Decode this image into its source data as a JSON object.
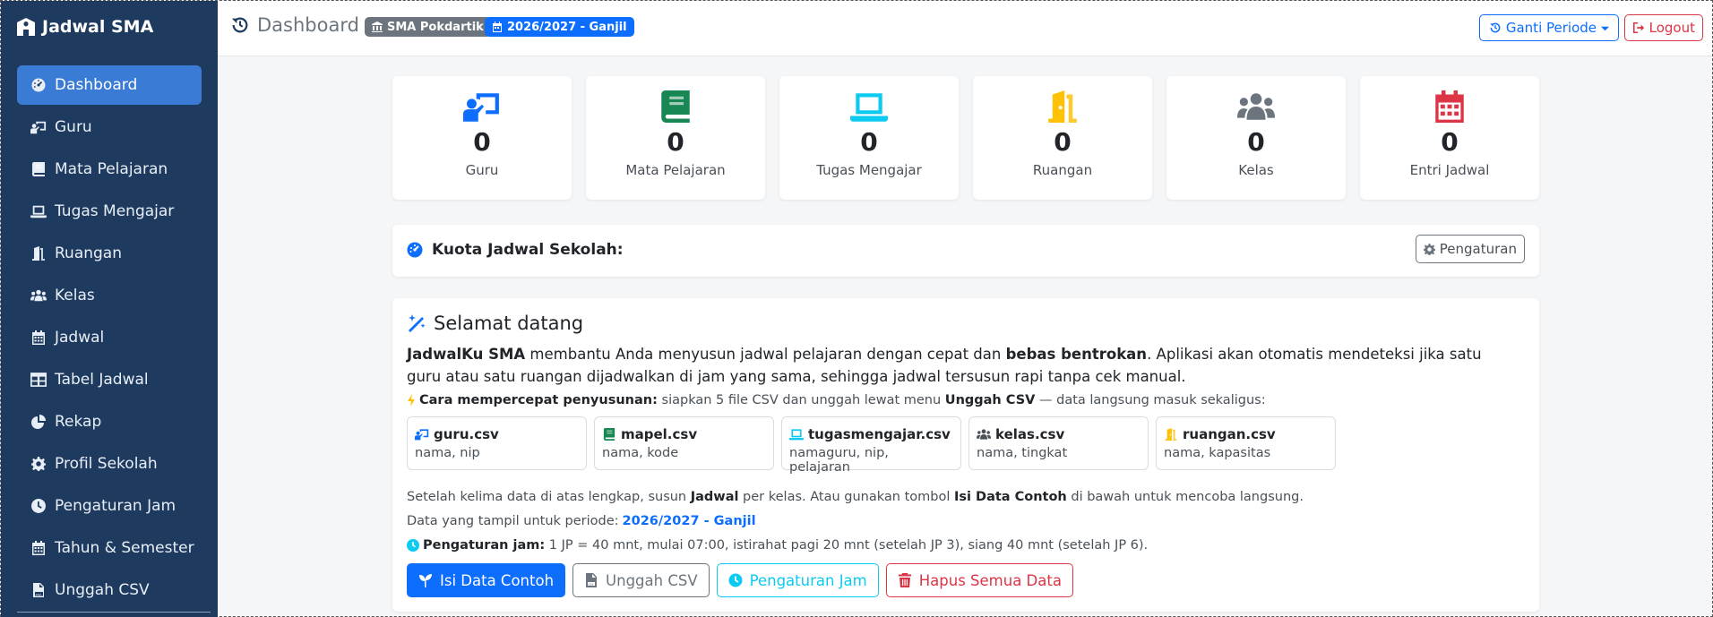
{
  "brand": {
    "name": "Jadwal SMA"
  },
  "sidebar": {
    "items": [
      {
        "label": "Dashboard",
        "icon": "dashboard-icon",
        "active": true
      },
      {
        "label": "Guru",
        "icon": "teacher-icon"
      },
      {
        "label": "Mata Pelajaran",
        "icon": "book-icon"
      },
      {
        "label": "Tugas Mengajar",
        "icon": "laptop-icon"
      },
      {
        "label": "Ruangan",
        "icon": "door-icon"
      },
      {
        "label": "Kelas",
        "icon": "users-icon"
      },
      {
        "label": "Jadwal",
        "icon": "calendar-icon"
      },
      {
        "label": "Tabel Jadwal",
        "icon": "table-icon"
      },
      {
        "label": "Rekap",
        "icon": "pie-chart-icon"
      },
      {
        "label": "Profil Sekolah",
        "icon": "gear-icon"
      },
      {
        "label": "Pengaturan Jam",
        "icon": "clock-icon"
      },
      {
        "label": "Tahun & Semester",
        "icon": "calendar-icon"
      },
      {
        "label": "Unggah CSV",
        "icon": "csv-file-icon"
      }
    ]
  },
  "header": {
    "title": "Dashboard",
    "school_badge": "SMA Pokdartik",
    "period_badge": "2026/2027 - Ganjil",
    "change_period_label": "Ganti Periode",
    "logout_label": "Logout"
  },
  "stats": [
    {
      "value": "0",
      "label": "Guru",
      "color": "#0d6efd",
      "icon": "teacher-icon"
    },
    {
      "value": "0",
      "label": "Mata Pelajaran",
      "color": "#198754",
      "icon": "book-icon"
    },
    {
      "value": "0",
      "label": "Tugas Mengajar",
      "color": "#0dcaf0",
      "icon": "laptop-icon"
    },
    {
      "value": "0",
      "label": "Ruangan",
      "color": "#ffc107",
      "icon": "door-icon"
    },
    {
      "value": "0",
      "label": "Kelas",
      "color": "#6c757d",
      "icon": "users-icon"
    },
    {
      "value": "0",
      "label": "Entri Jadwal",
      "color": "#dc3545",
      "icon": "calendar-icon"
    }
  ],
  "quota": {
    "title": "Kuota Jadwal Sekolah:",
    "settings_label": "Pengaturan"
  },
  "welcome": {
    "title": "Selamat datang",
    "desc_app": "JadwalKu SMA",
    "desc_1": " membantu Anda menyusun jadwal pelajaran dengan cepat dan ",
    "desc_bold": "bebas bentrokan",
    "desc_2": ". Aplikasi akan otomatis mendeteksi jika satu guru atau satu ruangan dijadwalkan di jam yang sama, sehingga jadwal tersusun rapi tanpa cek manual.",
    "tip_bold": "Cara mempercepat penyusunan:",
    "tip_text": " siapkan 5 file CSV dan unggah lewat menu ",
    "tip_menu": "Unggah CSV",
    "tip_end": " — data langsung masuk sekaligus:",
    "files": [
      {
        "name": "guru.csv",
        "cols": "nama, nip",
        "color": "#0d6efd",
        "icon": "teacher-icon"
      },
      {
        "name": "mapel.csv",
        "cols": "nama, kode",
        "color": "#198754",
        "icon": "book-icon"
      },
      {
        "name": "tugasmengajar.csv",
        "cols": "namaguru, nip, pelajaran",
        "color": "#0dcaf0",
        "icon": "laptop-icon"
      },
      {
        "name": "kelas.csv",
        "cols": "nama, tingkat",
        "color": "#495057",
        "icon": "users-icon"
      },
      {
        "name": "ruangan.csv",
        "cols": "nama, kapasitas",
        "color": "#ffc107",
        "icon": "door-icon"
      }
    ],
    "after_1": "Setelah kelima data di atas lengkap, susun ",
    "after_bold1": "Jadwal",
    "after_2": " per kelas. Atau gunakan tombol ",
    "after_bold2": "Isi Data Contoh",
    "after_3": " di bawah untuk mencoba langsung.",
    "period_label": "Data yang tampil untuk periode: ",
    "period_value": "2026/2027 - Ganjil",
    "hours_bold": "Pengaturan jam:",
    "hours_text": " 1 JP = 40 mnt, mulai 07:00, istirahat pagi 20 mnt (setelah JP 3), siang 40 mnt (setelah JP 6).",
    "buttons": {
      "sample": "Isi Data Contoh",
      "upload": "Unggah CSV",
      "hours": "Pengaturan Jam",
      "delete": "Hapus Semua Data"
    }
  }
}
